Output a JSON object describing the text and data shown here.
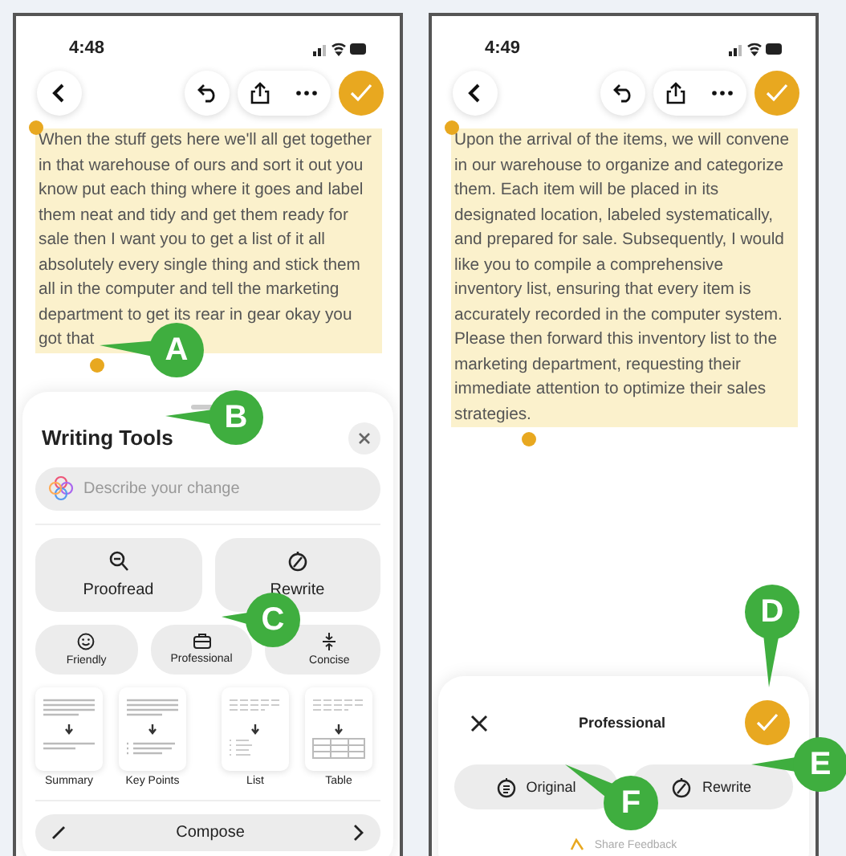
{
  "left_phone": {
    "status_time": "4:48",
    "text": "When the stuff gets here we'll all get together in that warehouse of ours and sort it out you know put each thing where it goes and label them neat and tidy and get them ready for sale then I want you to get a list of it all absolutely every single thing and stick them all in the computer and tell the marketing department to get its rear in gear okay you got that",
    "panel": {
      "title": "Writing Tools",
      "field": {
        "placeholder": "Describe your change"
      },
      "big_buttons": [
        {
          "label": "Proofread",
          "kind": "proofread"
        },
        {
          "label": "Rewrite",
          "kind": "rewrite"
        }
      ],
      "small_buttons": [
        {
          "label": "Friendly",
          "kind": "friendly"
        },
        {
          "label": "Professional",
          "kind": "professional"
        },
        {
          "label": "Concise",
          "kind": "concise"
        }
      ],
      "cards": [
        {
          "label": "Summary",
          "kind": "summary"
        },
        {
          "label": "Key Points",
          "kind": "keypoints"
        },
        {
          "label": "List",
          "kind": "list"
        },
        {
          "label": "Table",
          "kind": "table"
        }
      ],
      "compose": "Compose"
    }
  },
  "right_phone": {
    "status_time": "4:49",
    "text": "Upon the arrival of the items, we will convene in our warehouse to organize and categorize them. Each item will be placed in its designated location, labeled systematically, and prepared for sale. Subsequently, I would like you to compile a comprehensive inventory list, ensuring that every item is accurately recorded in the computer system. Please then forward this inventory list to the marketing department, requesting their immediate attention to optimize their sales strategies.",
    "panel": {
      "title": "Professional",
      "buttons": [
        {
          "label": "Original",
          "kind": "original"
        },
        {
          "label": "Rewrite",
          "kind": "rewrite"
        }
      ],
      "feedback": "Share Feedback"
    }
  },
  "callouts": [
    "A",
    "B",
    "C",
    "D",
    "E",
    "F"
  ]
}
